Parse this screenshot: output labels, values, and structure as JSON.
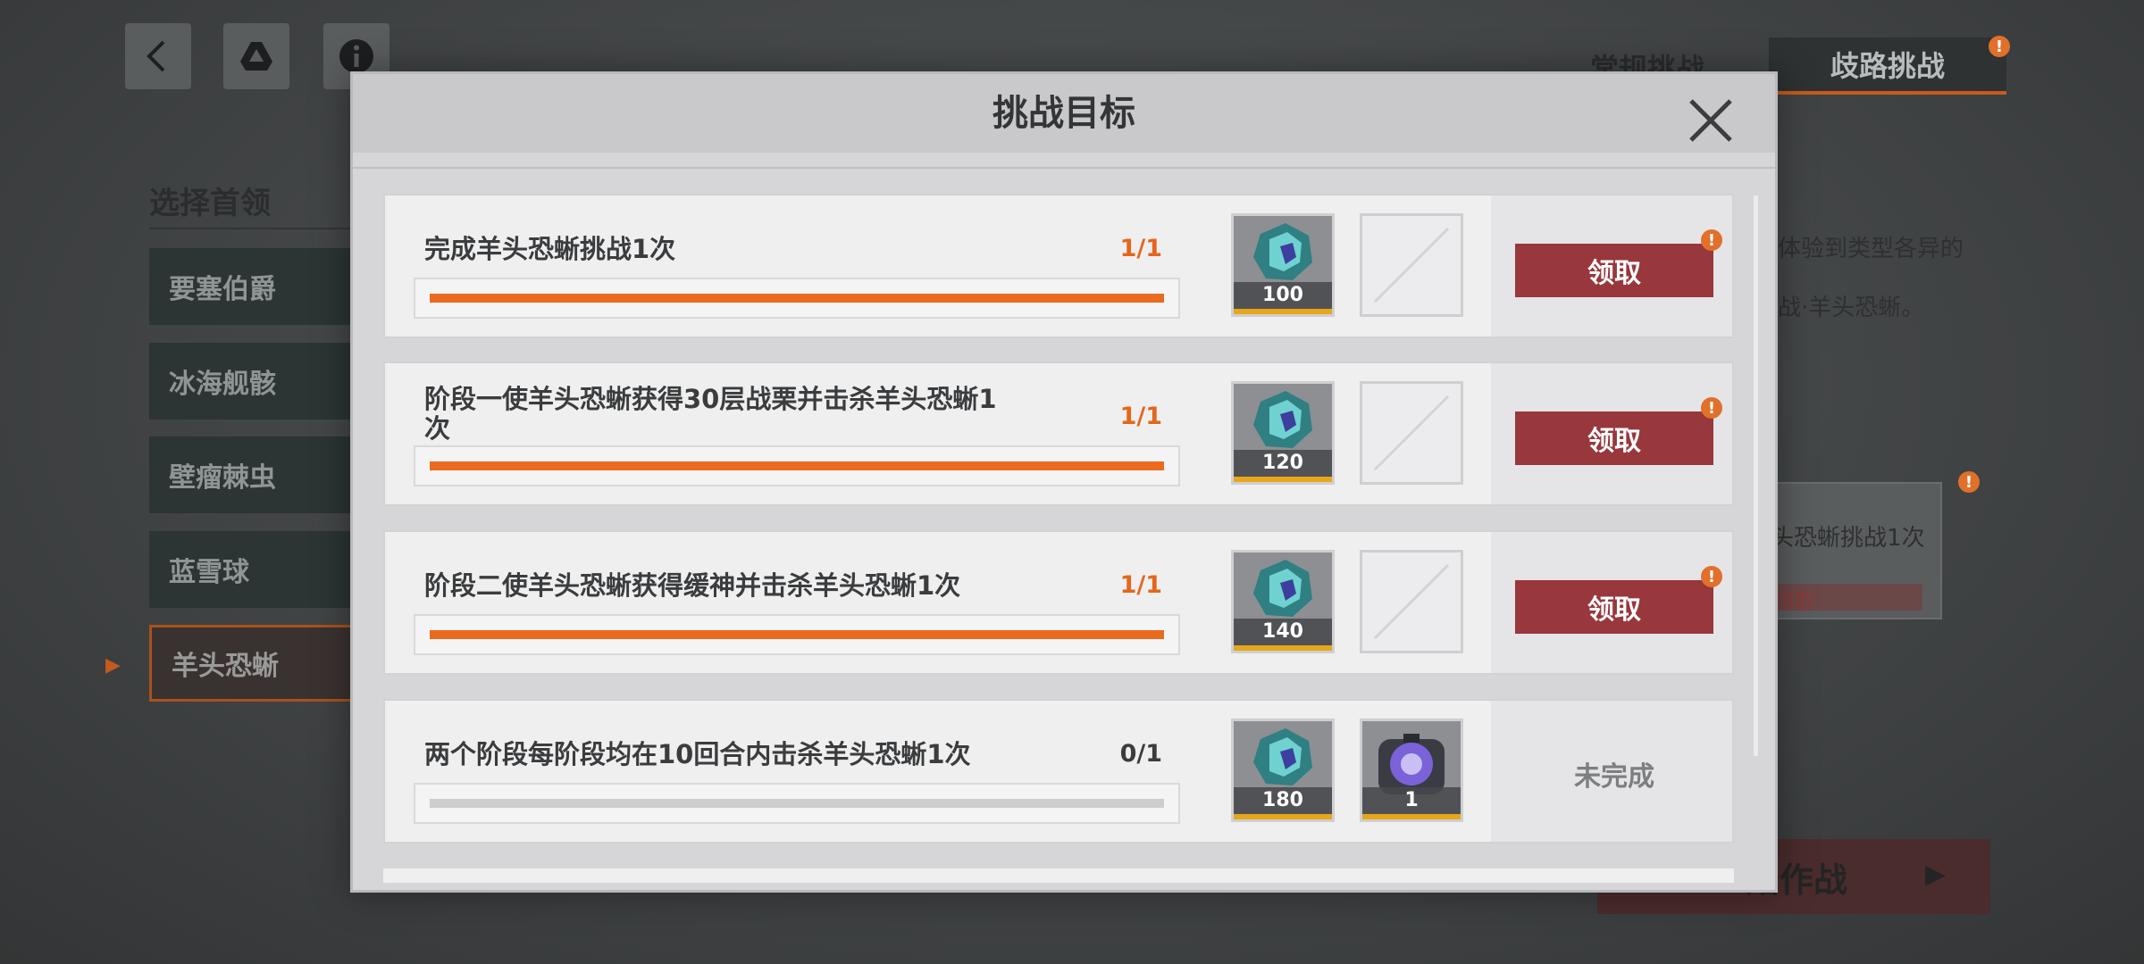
{
  "screen": {
    "boss_select_title": "选择首领",
    "bosses": [
      {
        "name": "要塞伯爵"
      },
      {
        "name": "冰海舰骸"
      },
      {
        "name": "壁瘤棘虫"
      },
      {
        "name": "蓝雪球"
      },
      {
        "name": "羊头恐蜥",
        "selected": true
      }
    ],
    "tabs": {
      "normal": "常规挑战",
      "branch": "歧路挑战"
    },
    "right_snippets": [
      "体验到类型各异的",
      "战·羊头恐蜥。",
      "头恐蜥挑战1次",
      "领取"
    ],
    "start_button_label": "始作战",
    "icons": [
      "back-arrow-icon",
      "drive-triangle-icon",
      "info-icon"
    ]
  },
  "modal": {
    "title": "挑战目标",
    "close_icon": "close-x-icon",
    "tasks": [
      {
        "description": "完成羊头恐蜥挑战1次",
        "progress_text": "1/1",
        "progress": 1.0,
        "rewards": [
          {
            "type": "crystal",
            "qty": "100"
          },
          {
            "type": "empty",
            "qty": ""
          }
        ],
        "status": "claimable",
        "claim_label": "领取"
      },
      {
        "description": "阶段一使羊头恐蜥获得30层战栗并击杀羊头恐蜥1次",
        "progress_text": "1/1",
        "progress": 1.0,
        "rewards": [
          {
            "type": "crystal",
            "qty": "120"
          },
          {
            "type": "empty",
            "qty": ""
          }
        ],
        "status": "claimable",
        "claim_label": "领取"
      },
      {
        "description": "阶段二使羊头恐蜥获得缓神并击杀羊头恐蜥1次",
        "progress_text": "1/1",
        "progress": 1.0,
        "rewards": [
          {
            "type": "crystal",
            "qty": "140"
          },
          {
            "type": "empty",
            "qty": ""
          }
        ],
        "status": "claimable",
        "claim_label": "领取"
      },
      {
        "description": "两个阶段每阶段均在10回合内击杀羊头恐蜥1次",
        "progress_text": "0/1",
        "progress": 0.0,
        "rewards": [
          {
            "type": "crystal",
            "qty": "180"
          },
          {
            "type": "orb",
            "qty": "1"
          }
        ],
        "status": "incomplete",
        "status_label": "未完成"
      }
    ]
  },
  "colors": {
    "accent_orange": "#ec6a1f",
    "claim_red": "#98373c",
    "reward_gold": "#e6a71a"
  }
}
